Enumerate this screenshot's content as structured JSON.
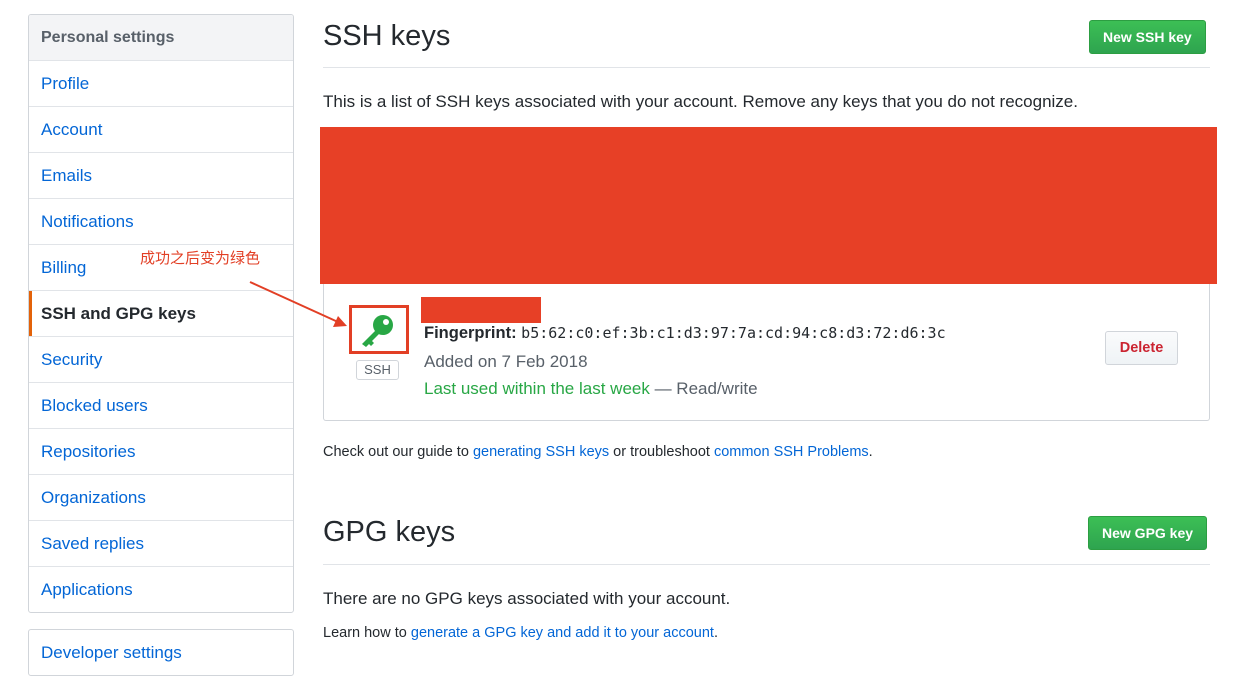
{
  "sidebar": {
    "header": "Personal settings",
    "items": [
      {
        "label": "Profile"
      },
      {
        "label": "Account"
      },
      {
        "label": "Emails"
      },
      {
        "label": "Notifications"
      },
      {
        "label": "Billing"
      },
      {
        "label": "SSH and GPG keys",
        "selected": true
      },
      {
        "label": "Security"
      },
      {
        "label": "Blocked users"
      },
      {
        "label": "Repositories"
      },
      {
        "label": "Organizations"
      },
      {
        "label": "Saved replies"
      },
      {
        "label": "Applications"
      }
    ],
    "developer_settings": "Developer settings"
  },
  "ssh": {
    "title": "SSH keys",
    "new_button": "New SSH key",
    "description": "This is a list of SSH keys associated with your account. Remove any keys that you do not recognize.",
    "key": {
      "type_label": "SSH",
      "fingerprint_label": "Fingerprint:",
      "fingerprint": "b5:62:c0:ef:3b:c1:d3:97:7a:cd:94:c8:d3:72:d6:3c",
      "added": "Added on 7 Feb 2018",
      "last_used": "Last used within the last week",
      "access": " — Read/write",
      "delete_button": "Delete",
      "icon": "key-icon",
      "icon_color": "#28a745"
    },
    "guide": {
      "prefix": "Check out our guide to ",
      "link1": "generating SSH keys",
      "middle": " or troubleshoot ",
      "link2": "common SSH Problems",
      "suffix": "."
    }
  },
  "gpg": {
    "title": "GPG keys",
    "new_button": "New GPG key",
    "empty": "There are no GPG keys associated with your account.",
    "learn_prefix": "Learn how to ",
    "learn_link": "generate a GPG key and add it to your account",
    "learn_suffix": "."
  },
  "annotation": {
    "text": "成功之后变为绿色",
    "color": "#e23f25"
  },
  "colors": {
    "link": "#0366d6",
    "primary_button": "#2ea44f",
    "danger": "#cb2431",
    "redaction": "#e74026"
  }
}
